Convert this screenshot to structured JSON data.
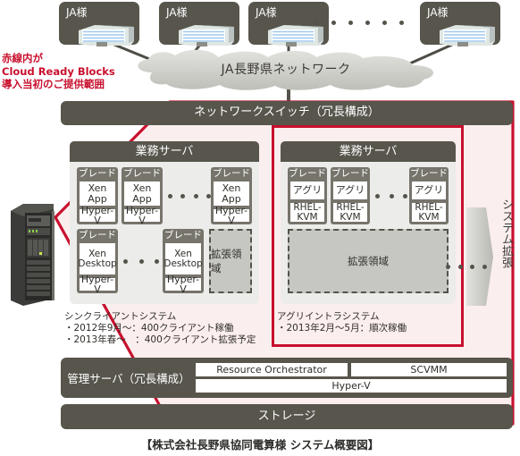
{
  "colors": {
    "dark": "#57554c",
    "panel": "#ececea",
    "red": "#c8102e",
    "red_fill": "#fbeeee",
    "ext_fill": "#c6c6c2"
  },
  "top_nodes": [
    {
      "label": "JA様"
    },
    {
      "label": "JA様"
    },
    {
      "label": "JA様"
    },
    {
      "label": "JA様"
    }
  ],
  "network": {
    "cloud_label": "JA長野県ネットワーク"
  },
  "red_note": {
    "line1": "赤線内が",
    "line2": "Cloud Ready Blocks",
    "line3": "導入当初のご提供範囲"
  },
  "switch": {
    "label": "ネットワークスイッチ（冗長構成）"
  },
  "left_group": {
    "title": "業務サーバ",
    "row1": {
      "blades": [
        {
          "head": "ブレード",
          "app": "Xen App",
          "hv": "Hyper-V"
        },
        {
          "head": "ブレード",
          "app": "Xen App",
          "hv": "Hyper-V"
        },
        {
          "head": "ブレード",
          "app": "Xen App",
          "hv": "Hyper-V"
        }
      ]
    },
    "row2": {
      "blades": [
        {
          "head": "ブレード",
          "app": "Xen Desktop",
          "hv": "Hyper-V"
        },
        {
          "head": "ブレード",
          "app": "Xen Desktop",
          "hv": "Hyper-V"
        }
      ],
      "expansion": "拡張領域"
    },
    "caption": {
      "title": "シンクライアントシステム",
      "line1": "・2012年9月～：400クライアント稼働",
      "line2": "・2013年春～　：400クライアント拡張予定"
    }
  },
  "right_group": {
    "title": "業務サーバ",
    "row1": {
      "blades": [
        {
          "head": "ブレード",
          "app": "アグリ",
          "hv": "RHEL-KVM"
        },
        {
          "head": "ブレード",
          "app": "アグリ",
          "hv": "RHEL-KVM"
        },
        {
          "head": "ブレード",
          "app": "アグリ",
          "hv": "RHEL-KVM"
        }
      ]
    },
    "expansion": "拡張領域",
    "caption": {
      "title": "アグリイントラシステム",
      "line1": "・2013年2月～5月：順次稼働"
    }
  },
  "system_expansion": {
    "label": "システム拡張"
  },
  "management": {
    "label": "管理サーバ（冗長構成）",
    "cells": [
      "Resource Orchestrator",
      "SCVMM"
    ],
    "hypervisor": "Hyper-V"
  },
  "storage": {
    "label": "ストレージ"
  },
  "caption": {
    "text": "【株式会社長野県協同電算様 システム概要図】"
  }
}
